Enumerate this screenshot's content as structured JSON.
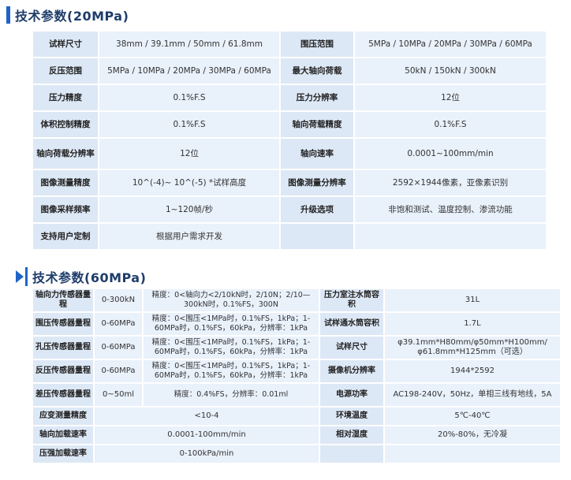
{
  "section1": {
    "title": "技术参数(20MPa)",
    "rows": [
      [
        {
          "label": "试样尺寸",
          "value": "38mm / 39.1mm / 50mm / 61.8mm"
        },
        {
          "label": "围压范围",
          "value": "5MPa / 10MPa / 20MPa / 30MPa / 60MPa"
        }
      ],
      [
        {
          "label": "反压范围",
          "value": "5MPa / 10MPa / 20MPa / 30MPa / 60MPa"
        },
        {
          "label": "最大轴向荷载",
          "value": "50kN / 150kN / 300kN"
        }
      ],
      [
        {
          "label": "压力精度",
          "value": "0.1%F.S"
        },
        {
          "label": "压力分辨率",
          "value": "12位"
        }
      ],
      [
        {
          "label": "体积控制精度",
          "value": "0.1%F.S"
        },
        {
          "label": "轴向荷载精度",
          "value": "0.1%F.S"
        }
      ],
      [
        {
          "label": "轴向荷载分辨率",
          "value": "12位"
        },
        {
          "label": "轴向速率",
          "value": "0.0001~100mm/min"
        }
      ],
      [
        {
          "label": "图像测量精度",
          "value": "10^(-4)~ 10^(-5) *试样高度"
        },
        {
          "label": "图像测量分辨率",
          "value": "2592×1944像素，亚像素识别"
        }
      ],
      [
        {
          "label": "图像采样频率",
          "value": "1~120帧/秒"
        },
        {
          "label": "升级选项",
          "value": "非饱和测试、温度控制、渗流功能"
        }
      ],
      [
        {
          "label": "支持用户定制",
          "value": "根据用户需求开发"
        },
        {
          "label": "",
          "value": ""
        }
      ]
    ]
  },
  "section2": {
    "title": "技术参数(60MPa)",
    "rows": [
      {
        "l1": "轴向力传感器量程",
        "r1": "0-300kN",
        "d1": "精度：0<轴向力<2/10kN时，2/10N；2/10—300kN时，0.1%FS，300N",
        "l2": "压力室注水筒容积",
        "v2": "31L"
      },
      {
        "l1": "围压传感器量程",
        "r1": "0-60MPa",
        "d1": "精度：0<围压<1MPa时，0.1%FS，1kPa；1-60MPa时，0.1%FS，60kPa，分辨率：1kPa",
        "l2": "试样通水筒容积",
        "v2": "1.7L"
      },
      {
        "l1": "孔压传感器量程",
        "r1": "0-60MPa",
        "d1": "精度：0<围压<1MPa时，0.1%FS，1kPa；1-60MPa时，0.1%FS，60kPa，分辨率：1kPa",
        "l2": "试样尺寸",
        "v2": "φ39.1mm*H80mm/φ50mm*H100mm/φ61.8mm*H125mm（可选）"
      },
      {
        "l1": "反压传感器量程",
        "r1": "0-60MPa",
        "d1": "精度：0<围压<1MPa时，0.1%FS，1kPa；1-60MPa时，0.1%FS，60kPa，分辨率：1kPa",
        "l2": "摄像机分辨率",
        "v2": "1944*2592"
      },
      {
        "l1": "差压传感器量程",
        "r1": "0~50ml",
        "d1": "精度：0.4%FS，分辨率：0.01ml",
        "l2": "电源功率",
        "v2": "AC198-240V，50Hz，单相三线有地线，5A"
      },
      {
        "l1": "应变测量精度",
        "r1": "",
        "d1": "<10-4",
        "l2": "环境温度",
        "v2": "5℃-40℃"
      },
      {
        "l1": "轴向加载速率",
        "r1": "",
        "d1": "0.0001-100mm/min",
        "l2": "相对湿度",
        "v2": "20%-80%，无冷凝"
      },
      {
        "l1": "压强加载速率",
        "r1": "",
        "d1": "0-100kPa/min",
        "l2": "",
        "v2": ""
      }
    ]
  }
}
